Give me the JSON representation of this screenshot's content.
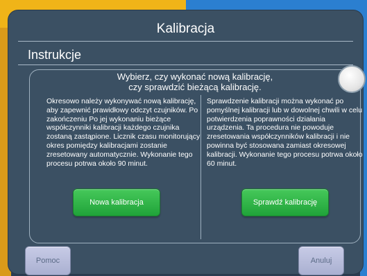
{
  "dialog": {
    "title": "Kalibracja",
    "subheading": "Instrukcje",
    "prompt_line1": "Wybierz, czy wykonać nową kalibrację,",
    "prompt_line2": "czy sprawdzić bieżącą kalibrację."
  },
  "options": {
    "left_text": "Okresowo należy wykonywać nową kalibrację, aby zapewnić prawidłowy odczyt czujników. Po zakończeniu Po jej wykonaniu bieżące współczynniki kalibracji każdego czujnika zostaną zastąpione. Licznik czasu monitorujący okres pomiędzy kalibracjami zostanie zresetowany automatycznie. Wykonanie tego procesu potrwa około 90 minut.",
    "right_text": "Sprawdzenie kalibracji można wykonać po pomyślnej kalibracji lub w dowolnej chwili w celu potwierdzenia poprawności działania urządzenia. Ta procedura nie powoduje zresetowania współczynników kalibracji i nie powinna być stosowana zamiast okresowej kalibracji. Wykonanie tego procesu potrwa około 60 minut.",
    "new_button": "Nowa kalibracja",
    "check_button": "Sprawdź kalibrację"
  },
  "footer": {
    "help_button": "Pomoc",
    "cancel_button": "Anuluj"
  },
  "colors": {
    "panel": "#3b5063",
    "green_button": "#2bb043",
    "footer_button": "#b8bddb",
    "accent_yellow": "#f0b418",
    "accent_blue": "#2b7fd0"
  }
}
